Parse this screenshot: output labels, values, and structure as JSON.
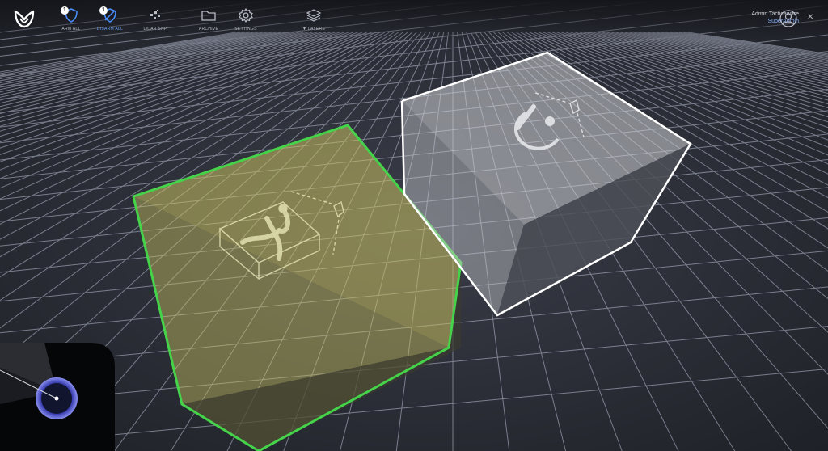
{
  "toolbar": {
    "items": [
      {
        "label": "ARM ALL",
        "badge": "1"
      },
      {
        "label": "DISARM ALL",
        "badge": "1"
      },
      {
        "label": "LIDAR SNP"
      },
      {
        "label": "ARCHIVE"
      },
      {
        "label": "SETTINGS"
      },
      {
        "label": "LAYERS"
      }
    ]
  },
  "user": {
    "name": "Admin Tacticaware",
    "role": "SuperAdmin"
  },
  "colors": {
    "accent": "#45d34a",
    "zone_fill": "#c8c060",
    "selected_outline": "#ffffff",
    "grid_line": "#bcc3d6",
    "background": "#2a2c34"
  },
  "icons": {
    "logo": "tacticaware-logo-icon",
    "zone_a": "intruder-detection-icon",
    "zone_b": "timer-sensor-icon",
    "radar": "radar-icon"
  }
}
